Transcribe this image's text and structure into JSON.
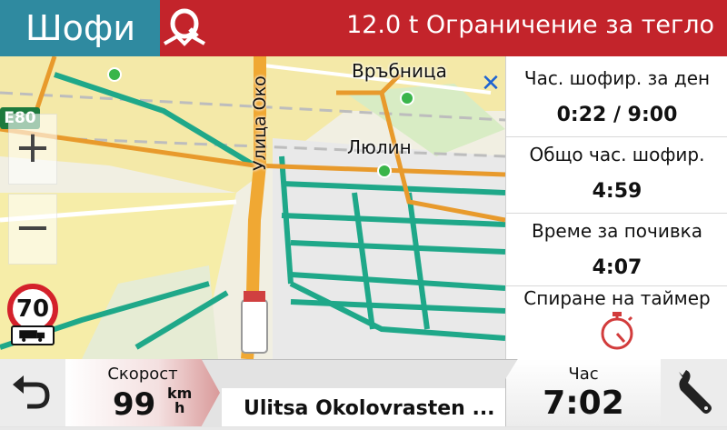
{
  "header": {
    "tab_title": "Шофи",
    "alert_text": "12.0 t Ограничение за тегло",
    "alert_icon": "weight-limit-icon"
  },
  "map": {
    "road_sign": "E80",
    "speed_limit": "70",
    "street_vertical": "Улица Око",
    "places": [
      "Връбница",
      "Люлин"
    ]
  },
  "panel": {
    "drive_today_label": "Час. шофир. за ден",
    "drive_today_value": "0:22 / 9:00",
    "total_drive_label": "Общо час. шофир.",
    "total_drive_value": "4:59",
    "rest_label": "Време за почивка",
    "rest_value": "4:07",
    "stop_timer_label": "Спиране на таймер"
  },
  "bottom": {
    "speed_label": "Скорост",
    "speed_value": "99",
    "speed_unit_top": "km",
    "speed_unit_bottom": "h",
    "street": "Ulitsa Okolovrasten ...",
    "time_label": "Час",
    "time_value": "7:02"
  },
  "colors": {
    "accent_red": "#c3242b",
    "tab_teal": "#2f8aa0",
    "route_orange": "#e89a2c",
    "road_green": "#1fa889"
  }
}
